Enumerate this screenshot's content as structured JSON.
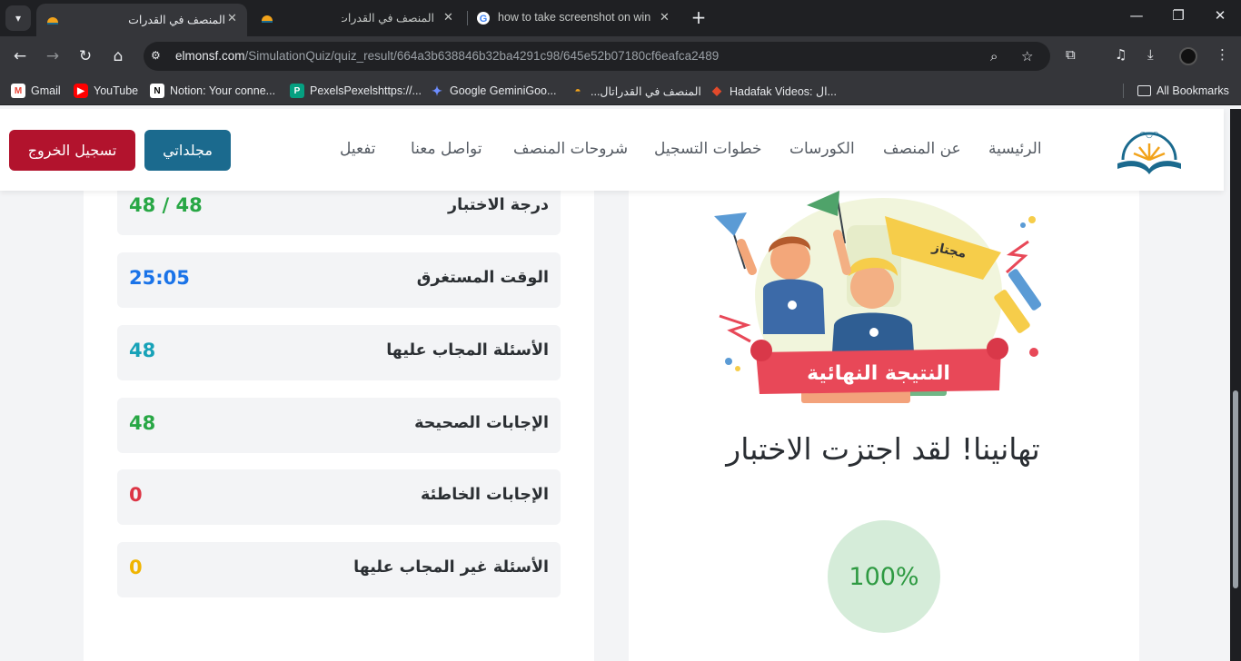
{
  "browser": {
    "tabs": [
      {
        "title": "المنصف في القدرات",
        "active": true
      },
      {
        "title": "المنصف في القدرات",
        "active": false
      },
      {
        "title": "how to take screenshot on wind",
        "active": false
      }
    ],
    "address": {
      "domain": "elmonsf.com",
      "path": "/SimulationQuiz/quiz_result/664a3b638846b32ba4291c98/645e52b07180cf6eafca2489"
    },
    "bookmarks": [
      {
        "label": "Gmail",
        "icon": "gmail-icon"
      },
      {
        "label": "YouTube",
        "icon": "youtube-icon"
      },
      {
        "label": "Notion: Your conne...",
        "icon": "notion-icon"
      },
      {
        "label": "PexelsPexelshttps://...",
        "icon": "pexels-icon"
      },
      {
        "label": "Google GeminiGoo...",
        "icon": "gemini-icon"
      },
      {
        "label": "المنصف في القدراتال...",
        "icon": "monsf-icon"
      },
      {
        "label": "Hadafak Videos: ال...",
        "icon": "hadafak-icon"
      }
    ],
    "all_bookmarks": "All Bookmarks"
  },
  "site": {
    "nav": {
      "home": "الرئيسية",
      "about": "عن المنصف",
      "courses": "الكورسات",
      "signup_steps": "خطوات التسجيل",
      "explanations": "شروحات المنصف",
      "contact": "تواصل معنا",
      "activate": "تفعيل"
    },
    "buttons": {
      "folders": "مجلداتي",
      "logout": "تسجيل الخروج"
    }
  },
  "results": {
    "stats": [
      {
        "label": "درجة الاختبار",
        "value": "48 / 48",
        "color": "#28a745"
      },
      {
        "label": "الوقت المستغرق",
        "value": "25:05",
        "color": "#1a73e8"
      },
      {
        "label": "الأسئلة المجاب عليها",
        "value": "48",
        "color": "#17a2b8"
      },
      {
        "label": "الإجابات الصحيحة",
        "value": "48",
        "color": "#28a745"
      },
      {
        "label": "الإجابات الخاطئة",
        "value": "0",
        "color": "#dc3545"
      },
      {
        "label": "الأسئلة غير المجاب عليها",
        "value": "0",
        "color": "#f0b400"
      }
    ],
    "banner_text": "النتيجة النهائية",
    "flag_text": "مجتاز",
    "congrats": "تهانينا! لقد اجتزت الاختبار",
    "score_percent": "100%"
  }
}
